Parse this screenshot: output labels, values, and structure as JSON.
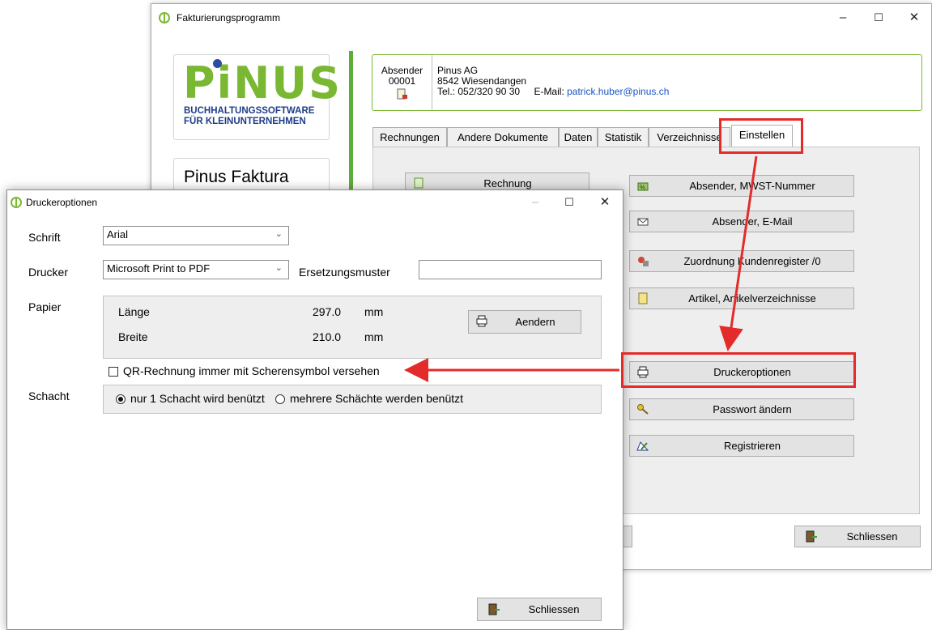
{
  "main_window": {
    "title": "Fakturierungsprogramm",
    "controls": {
      "minimize": "–",
      "maximize": "☐",
      "close": "✕"
    },
    "logo": {
      "text": "PiNUS",
      "sub1": "BUCHHALTUNGSSOFTWARE",
      "sub2": "FÜR KLEINUNTERNEHMEN"
    },
    "product_name": "Pinus Faktura",
    "sender": {
      "label": "Absender",
      "number": "00001",
      "company": "Pinus AG",
      "city": "8542 Wiesendangen",
      "phone": "Tel.: 052/320 90 30",
      "email_label": "E-Mail:",
      "email": "patrick.huber@pinus.ch"
    },
    "tabs": [
      {
        "label": "Rechnungen"
      },
      {
        "label": "Andere Dokumente"
      },
      {
        "label": "Daten"
      },
      {
        "label": "Statistik"
      },
      {
        "label": "Verzeichnisse"
      },
      {
        "label": "Einstellen",
        "active": true
      }
    ],
    "buttons": {
      "rechnung": "Rechnung",
      "absender_mwst": "Absender, MWST-Nummer",
      "absender_email": "Absender, E-Mail",
      "zuordnung": "Zuordnung Kundenregister /0",
      "artikel": "Artikel, Artikelverzeichnisse",
      "druckeroptionen": "Druckeroptionen",
      "passwort": "Passwort ändern",
      "registrieren": "Registrieren",
      "schliessen": "Schliessen"
    }
  },
  "dialog": {
    "title": "Druckeroptionen",
    "controls": {
      "minimize": "–",
      "maximize": "☐",
      "close": "✕"
    },
    "schrift": {
      "label": "Schrift",
      "value": "Arial"
    },
    "drucker": {
      "label": "Drucker",
      "value": "Microsoft Print to PDF"
    },
    "ersetzungsmuster": {
      "label": "Ersetzungsmuster",
      "value": ""
    },
    "papier": {
      "label": "Papier",
      "laenge_label": "Länge",
      "laenge_value": "297.0",
      "laenge_unit": "mm",
      "breite_label": "Breite",
      "breite_value": "210.0",
      "breite_unit": "mm",
      "aendern_button": "Aendern"
    },
    "qr_checkbox": {
      "label": "QR-Rechnung immer mit Scherensymbol versehen",
      "checked": false
    },
    "schacht": {
      "label": "Schacht",
      "option1": "nur 1 Schacht wird benützt",
      "option2": "mehrere Schächte werden benützt",
      "selected": 1
    },
    "schliessen_button": "Schliessen"
  },
  "annotation_color": "#e32b2b",
  "accent_green": "#7ab833"
}
